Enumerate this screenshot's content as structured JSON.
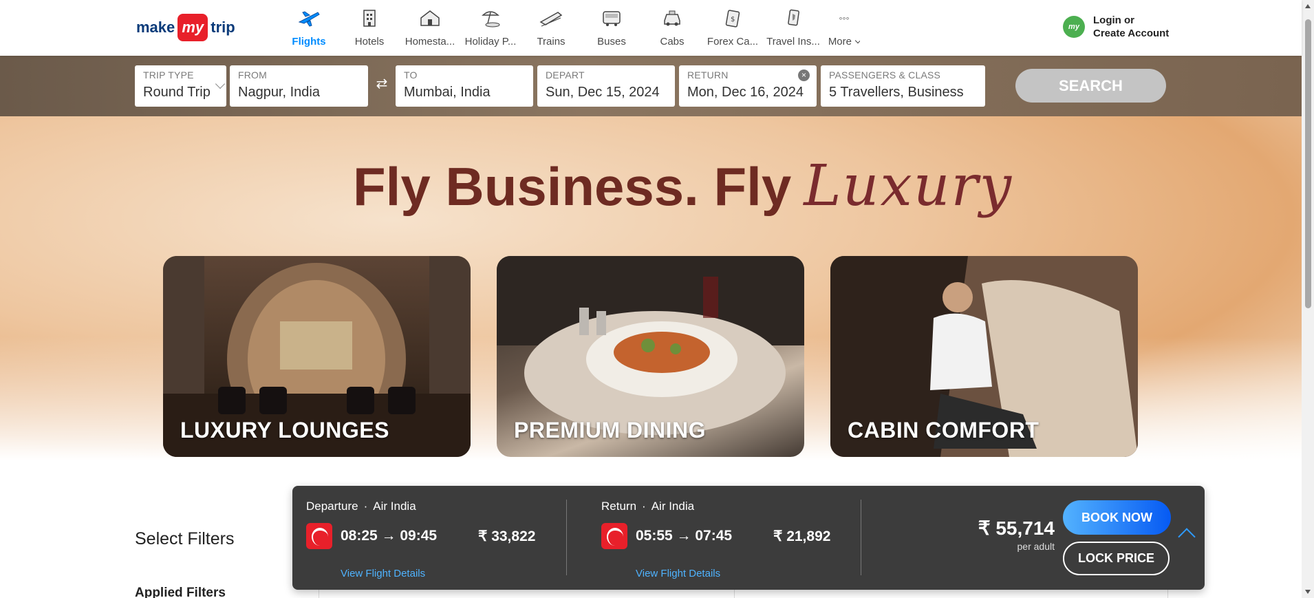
{
  "brand": {
    "logo_left": "make",
    "logo_mid": "my",
    "logo_right": "trip"
  },
  "nav": {
    "items": [
      {
        "label": "Flights",
        "icon": "flight-icon"
      },
      {
        "label": "Hotels",
        "icon": "hotel-icon"
      },
      {
        "label": "Homesta...",
        "icon": "homestay-icon"
      },
      {
        "label": "Holiday P...",
        "icon": "holiday-icon"
      },
      {
        "label": "Trains",
        "icon": "train-icon"
      },
      {
        "label": "Buses",
        "icon": "bus-icon"
      },
      {
        "label": "Cabs",
        "icon": "cab-icon"
      },
      {
        "label": "Forex Ca...",
        "icon": "forex-icon"
      },
      {
        "label": "Travel Ins...",
        "icon": "insurance-icon"
      }
    ],
    "more_label": "More",
    "more_dots": "◦◦◦",
    "active": "Flights"
  },
  "account": {
    "avatar": "my",
    "line1": "Login or",
    "line2": "Create Account"
  },
  "search": {
    "trip_type_label": "TRIP TYPE",
    "trip_type_value": "Round Trip",
    "from_label": "FROM",
    "from_value": "Nagpur, India",
    "swap_icon": "⇄",
    "to_label": "TO",
    "to_value": "Mumbai, India",
    "depart_label": "DEPART",
    "depart_value": "Sun, Dec 15, 2024",
    "return_label": "RETURN",
    "return_value": "Mon, Dec 16, 2024",
    "clear_icon": "×",
    "pax_label": "PASSENGERS & CLASS",
    "pax_value": "5 Travellers, Business",
    "search_button": "SEARCH"
  },
  "hero": {
    "title_main": "Fly Business. Fly",
    "title_script": "Luxury",
    "cards": [
      {
        "caption": "LUXURY LOUNGES"
      },
      {
        "caption": "PREMIUM DINING"
      },
      {
        "caption": "CABIN COMFORT"
      }
    ]
  },
  "filters": {
    "title": "Select Filters",
    "applied": "Applied Filters"
  },
  "booking_bar": {
    "departure": {
      "label": "Departure",
      "airline": "Air India",
      "dot": "·",
      "times": "08:25 → 09:45",
      "price": "₹ 33,822",
      "link": "View Flight Details"
    },
    "return": {
      "label": "Return",
      "airline": "Air India",
      "dot": "·",
      "times": "05:55 → 07:45",
      "price": "₹ 21,892",
      "link": "View Flight Details"
    },
    "total": "₹ 55,714",
    "per": "per adult",
    "book_now": "BOOK NOW",
    "lock_price": "LOCK PRICE"
  },
  "colors": {
    "accent": "#008cff",
    "brand_red": "#e8202a",
    "hero_title": "#6e2b22",
    "bookbar_bg": "#3c3c3c"
  }
}
